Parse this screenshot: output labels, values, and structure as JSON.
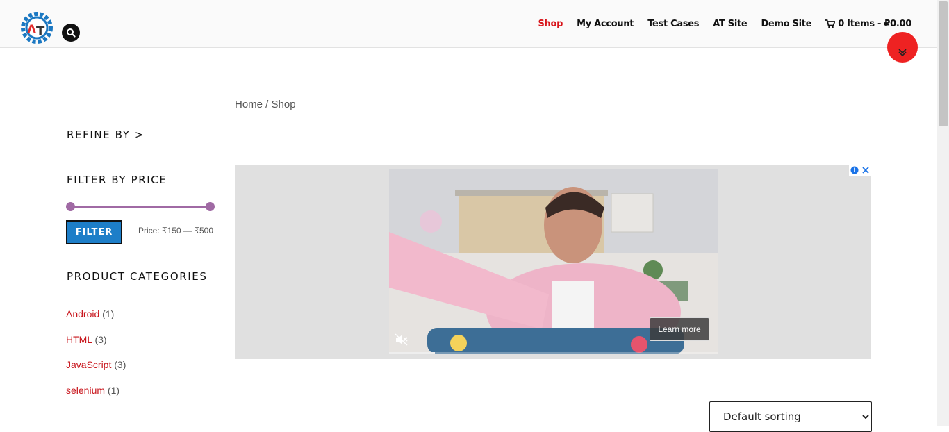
{
  "header": {
    "logo_letters": "AT",
    "nav": [
      {
        "label": "Shop",
        "active": true
      },
      {
        "label": "My Account"
      },
      {
        "label": "Test Cases"
      },
      {
        "label": "AT Site"
      },
      {
        "label": "Demo Site"
      }
    ],
    "cart_label": "0 Items - ₽0.00",
    "icons": {
      "search": "search-icon",
      "cart": "cart-icon",
      "scroll": "chevron-down-icon"
    }
  },
  "breadcrumb": {
    "home": "Home",
    "separator": " / ",
    "current": "Shop"
  },
  "sidebar": {
    "refine_title": "REFINE BY >",
    "price_title": "FILTER BY PRICE",
    "price_range": {
      "min": 150,
      "max": 500
    },
    "filter_button": "FILTER",
    "price_text": "Price: ₹150 — ₹500",
    "categories_title": "PRODUCT CATEGORIES",
    "categories": [
      {
        "name": "Android",
        "count": "(1)"
      },
      {
        "name": "HTML",
        "count": "(3)"
      },
      {
        "name": "JavaScript",
        "count": "(3)"
      },
      {
        "name": "selenium",
        "count": "(1)"
      }
    ]
  },
  "ad": {
    "learn_more": "Learn more",
    "icons": [
      "info-icon",
      "close-icon",
      "mute-icon"
    ],
    "progress_fraction": 0.14
  },
  "sorting": {
    "selected": "Default sorting"
  },
  "colors": {
    "accent_red": "#d8151b",
    "slider": "#a06aa4",
    "filter_button": "#1d7ec8",
    "fab": "#ee2222"
  }
}
